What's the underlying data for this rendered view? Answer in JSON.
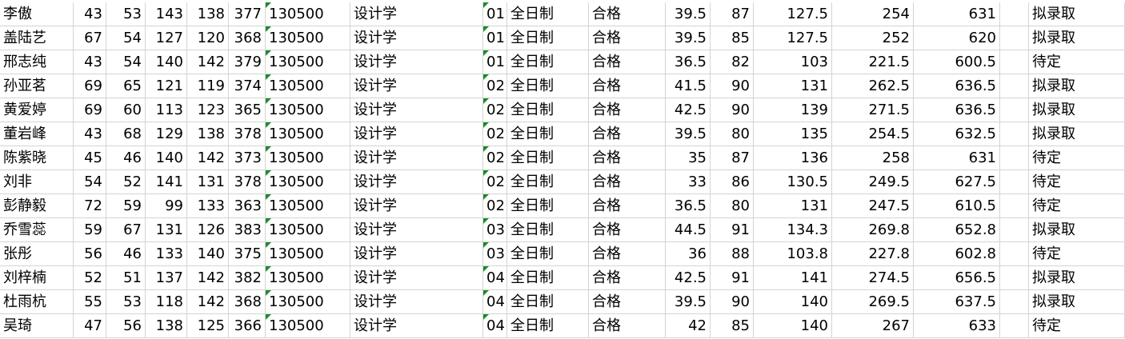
{
  "sheet": {
    "rows": [
      {
        "name": "李傲",
        "s1": "43",
        "s2": "53",
        "s3": "143",
        "s4": "138",
        "total": "377",
        "code": "130500",
        "major": "设计学",
        "dir": "01",
        "mode": "全日制",
        "result": "合格",
        "f1": "39.5",
        "f2": "87",
        "f3": "127.5",
        "f4": "254",
        "final": "631",
        "status": "拟录取"
      },
      {
        "name": "盖陆艺",
        "s1": "67",
        "s2": "54",
        "s3": "127",
        "s4": "120",
        "total": "368",
        "code": "130500",
        "major": "设计学",
        "dir": "01",
        "mode": "全日制",
        "result": "合格",
        "f1": "39.5",
        "f2": "85",
        "f3": "127.5",
        "f4": "252",
        "final": "620",
        "status": "拟录取"
      },
      {
        "name": "邢志纯",
        "s1": "43",
        "s2": "54",
        "s3": "140",
        "s4": "142",
        "total": "379",
        "code": "130500",
        "major": "设计学",
        "dir": "01",
        "mode": "全日制",
        "result": "合格",
        "f1": "36.5",
        "f2": "82",
        "f3": "103",
        "f4": "221.5",
        "final": "600.5",
        "status": "待定"
      },
      {
        "name": "孙亚茗",
        "s1": "69",
        "s2": "65",
        "s3": "121",
        "s4": "119",
        "total": "374",
        "code": "130500",
        "major": "设计学",
        "dir": "02",
        "mode": "全日制",
        "result": "合格",
        "f1": "41.5",
        "f2": "90",
        "f3": "131",
        "f4": "262.5",
        "final": "636.5",
        "status": "拟录取"
      },
      {
        "name": "黄爱婷",
        "s1": "69",
        "s2": "60",
        "s3": "113",
        "s4": "123",
        "total": "365",
        "code": "130500",
        "major": "设计学",
        "dir": "02",
        "mode": "全日制",
        "result": "合格",
        "f1": "42.5",
        "f2": "90",
        "f3": "139",
        "f4": "271.5",
        "final": "636.5",
        "status": "拟录取"
      },
      {
        "name": "董岩峰",
        "s1": "43",
        "s2": "68",
        "s3": "129",
        "s4": "138",
        "total": "378",
        "code": "130500",
        "major": "设计学",
        "dir": "02",
        "mode": "全日制",
        "result": "合格",
        "f1": "39.5",
        "f2": "80",
        "f3": "135",
        "f4": "254.5",
        "final": "632.5",
        "status": "拟录取"
      },
      {
        "name": "陈紫晓",
        "s1": "45",
        "s2": "46",
        "s3": "140",
        "s4": "142",
        "total": "373",
        "code": "130500",
        "major": "设计学",
        "dir": "02",
        "mode": "全日制",
        "result": "合格",
        "f1": "35",
        "f2": "87",
        "f3": "136",
        "f4": "258",
        "final": "631",
        "status": "待定"
      },
      {
        "name": "刘非",
        "s1": "54",
        "s2": "52",
        "s3": "141",
        "s4": "131",
        "total": "378",
        "code": "130500",
        "major": "设计学",
        "dir": "02",
        "mode": "全日制",
        "result": "合格",
        "f1": "33",
        "f2": "86",
        "f3": "130.5",
        "f4": "249.5",
        "final": "627.5",
        "status": "待定"
      },
      {
        "name": "彭静毅",
        "s1": "72",
        "s2": "59",
        "s3": "99",
        "s4": "133",
        "total": "363",
        "code": "130500",
        "major": "设计学",
        "dir": "02",
        "mode": "全日制",
        "result": "合格",
        "f1": "36.5",
        "f2": "80",
        "f3": "131",
        "f4": "247.5",
        "final": "610.5",
        "status": "待定"
      },
      {
        "name": "乔雪蕊",
        "s1": "59",
        "s2": "67",
        "s3": "131",
        "s4": "126",
        "total": "383",
        "code": "130500",
        "major": "设计学",
        "dir": "03",
        "mode": "全日制",
        "result": "合格",
        "f1": "44.5",
        "f2": "91",
        "f3": "134.3",
        "f4": "269.8",
        "final": "652.8",
        "status": "拟录取"
      },
      {
        "name": "张彤",
        "s1": "56",
        "s2": "46",
        "s3": "133",
        "s4": "140",
        "total": "375",
        "code": "130500",
        "major": "设计学",
        "dir": "03",
        "mode": "全日制",
        "result": "合格",
        "f1": "36",
        "f2": "88",
        "f3": "103.8",
        "f4": "227.8",
        "final": "602.8",
        "status": "待定"
      },
      {
        "name": "刘梓楠",
        "s1": "52",
        "s2": "51",
        "s3": "137",
        "s4": "142",
        "total": "382",
        "code": "130500",
        "major": "设计学",
        "dir": "04",
        "mode": "全日制",
        "result": "合格",
        "f1": "42.5",
        "f2": "91",
        "f3": "141",
        "f4": "274.5",
        "final": "656.5",
        "status": "拟录取"
      },
      {
        "name": "杜雨杭",
        "s1": "55",
        "s2": "53",
        "s3": "118",
        "s4": "142",
        "total": "368",
        "code": "130500",
        "major": "设计学",
        "dir": "04",
        "mode": "全日制",
        "result": "合格",
        "f1": "39.5",
        "f2": "90",
        "f3": "140",
        "f4": "269.5",
        "final": "637.5",
        "status": "拟录取"
      },
      {
        "name": "吴琦",
        "s1": "47",
        "s2": "56",
        "s3": "138",
        "s4": "125",
        "total": "366",
        "code": "130500",
        "major": "设计学",
        "dir": "04",
        "mode": "全日制",
        "result": "合格",
        "f1": "42",
        "f2": "85",
        "f3": "140",
        "f4": "267",
        "final": "633",
        "status": "待定"
      }
    ]
  },
  "colors": {
    "gridline": "#d4d4d4",
    "text": "#000000",
    "flag_triangle": "#1f8a2c",
    "background": "#ffffff"
  }
}
